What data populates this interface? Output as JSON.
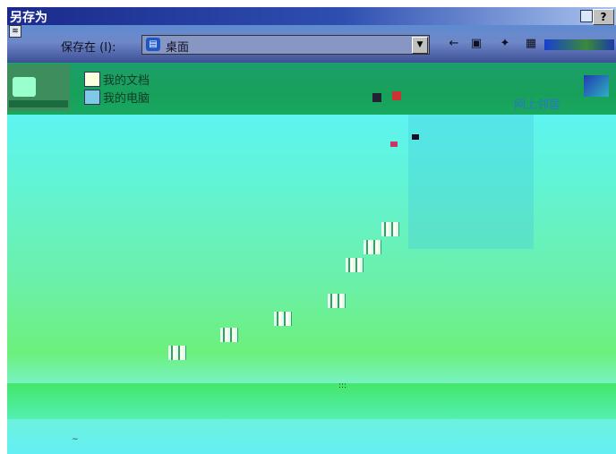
{
  "window": {
    "title": "另存为",
    "help_label": "?"
  },
  "toolbar": {
    "save_in_label": "保存在 (I):",
    "location_value": "桌面",
    "location_icon": "desktop-icon",
    "back_icon": "←",
    "up_icon": "▣",
    "new_folder_icon": "✦",
    "views_icon": "▦"
  },
  "file_list": {
    "items": [
      {
        "label": "我的文档",
        "icon": "folder-icon"
      },
      {
        "label": "我的电脑",
        "icon": "computer-icon"
      }
    ],
    "right_label": "网上邻居"
  },
  "colors": {
    "title_bar": "#1a2a8c",
    "toolbar": "#5e8bd0",
    "band": "#17a05a",
    "body_top": "#5ef4f2",
    "body_mid": "#6cf07c",
    "right_label": "#2a78c0"
  }
}
